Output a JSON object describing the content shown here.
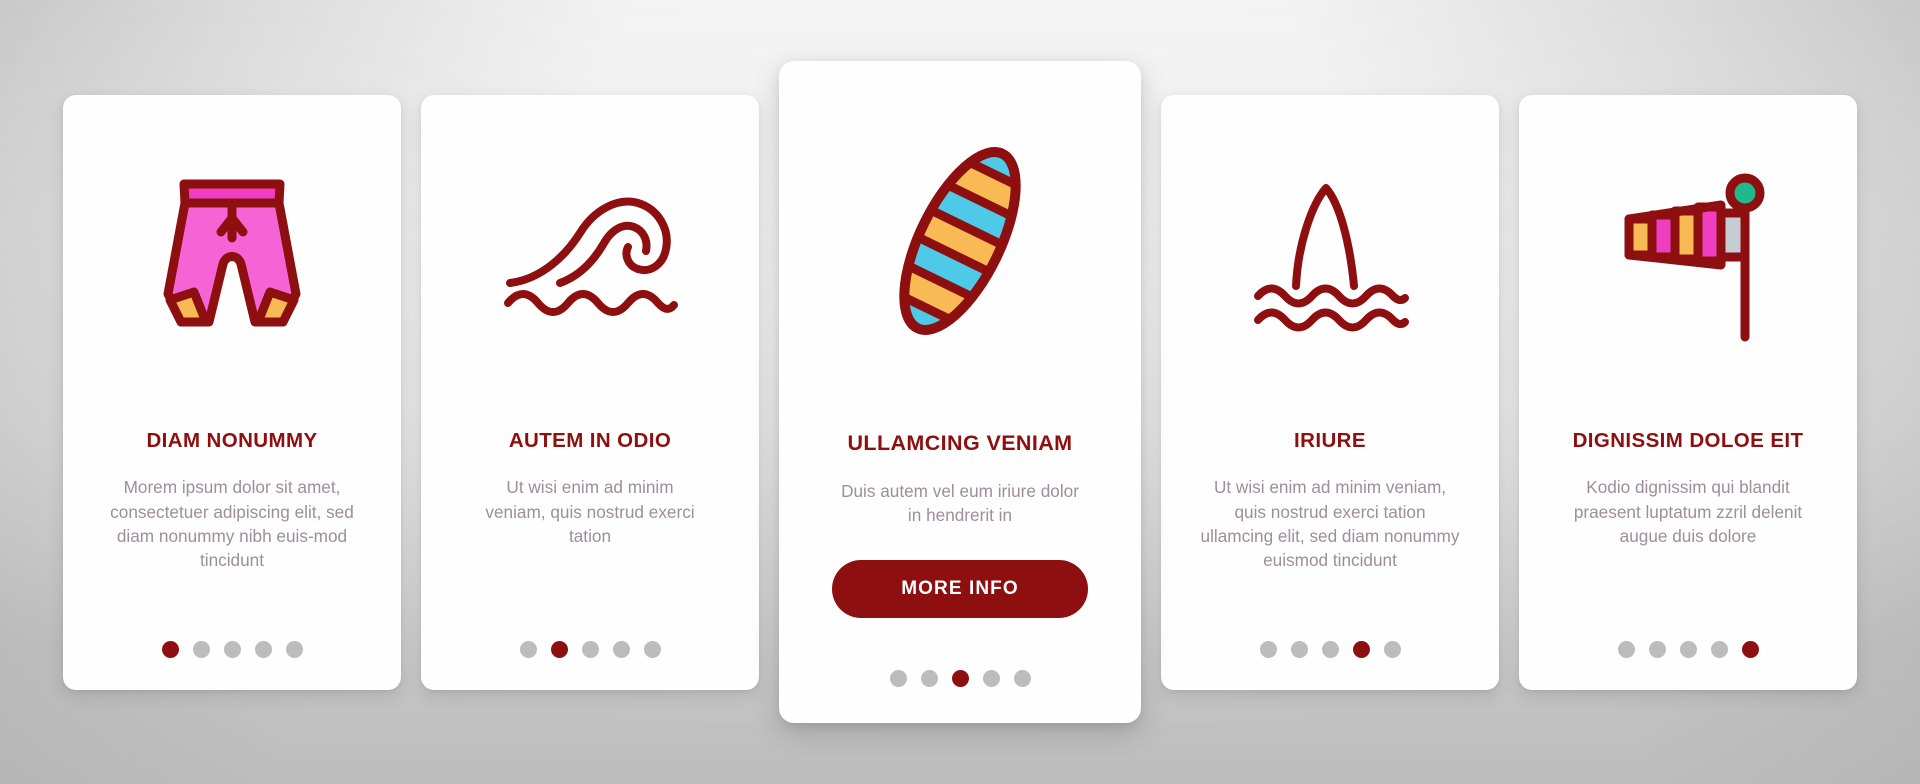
{
  "background": {
    "color": "#cfcfcf"
  },
  "theme": {
    "accent": "#8e0f0f",
    "title_color": "#8e0f0f",
    "body_color": "#9c8f9b",
    "card_bg": "#fefeff",
    "dot_inactive": "#bcbcbc",
    "dot_active": "#8e0f0f",
    "icon_stroke": "#8e0f0f",
    "icon_pink": "#f564d4",
    "icon_magenta": "#ef3fc0",
    "icon_orange": "#f9b955",
    "icon_cyan": "#4ec9e8",
    "icon_gray": "#c6ccd4",
    "icon_green": "#1eb98c"
  },
  "cards": [
    {
      "id": "card-1",
      "icon": "swim-shorts-icon",
      "title": "DIAM NONUMMY",
      "body": "Morem ipsum dolor sit amet, consectetuer adipiscing elit, sed diam nonummy nibh euis-mod tincidunt",
      "has_button": false,
      "button_label": "",
      "dots": {
        "count": 5,
        "active_index": 0
      },
      "featured": false
    },
    {
      "id": "card-2",
      "icon": "wave-icon",
      "title": "AUTEM IN ODIO",
      "body": "Ut wisi enim ad minim veniam, quis nostrud exerci tation",
      "has_button": false,
      "button_label": "",
      "dots": {
        "count": 5,
        "active_index": 1
      },
      "featured": false
    },
    {
      "id": "card-3",
      "icon": "surfboard-icon",
      "title": "ULLAMCING VENIAM",
      "body": "Duis autem vel eum iriure dolor in hendrerit in",
      "has_button": true,
      "button_label": "MORE INFO",
      "dots": {
        "count": 5,
        "active_index": 2
      },
      "featured": true
    },
    {
      "id": "card-4",
      "icon": "shark-fin-icon",
      "title": "IRIURE",
      "body": "Ut wisi enim ad minim veniam, quis nostrud exerci tation ullamcing elit, sed diam nonummy euismod tincidunt",
      "has_button": false,
      "button_label": "",
      "dots": {
        "count": 5,
        "active_index": 3
      },
      "featured": false
    },
    {
      "id": "card-5",
      "icon": "windsock-icon",
      "title": "DIGNISSIM DOLOE EIT",
      "body": "Kodio dignissim qui blandit praesent luptatum zzril delenit augue duis dolore",
      "has_button": false,
      "button_label": "",
      "dots": {
        "count": 5,
        "active_index": 4
      },
      "featured": false
    }
  ]
}
